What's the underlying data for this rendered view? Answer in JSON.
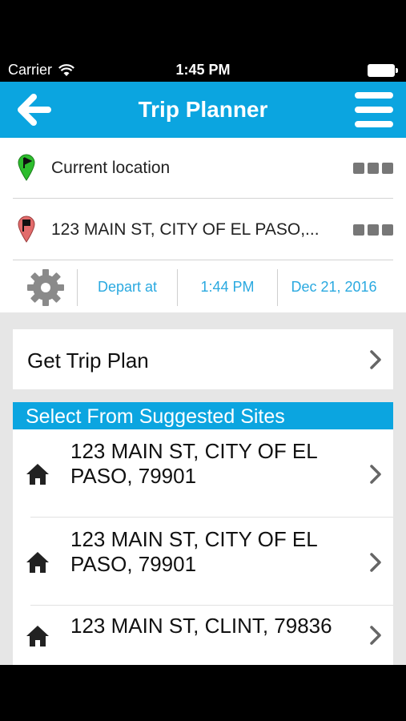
{
  "status_bar": {
    "carrier": "Carrier",
    "time": "1:45 PM"
  },
  "header": {
    "title": "Trip Planner",
    "back_icon": "arrow-left-icon",
    "menu_icon": "hamburger-menu-icon",
    "color": "#0ba5e0"
  },
  "locations": {
    "origin": {
      "label": "Current location",
      "pin_color": "#2dbd2d"
    },
    "destination": {
      "label": "123 MAIN ST, CITY OF EL PASO,...",
      "pin_color": "#e26b6b"
    }
  },
  "options": {
    "depart_mode": "Depart at",
    "time": "1:44 PM",
    "date": "Dec 21, 2016",
    "accent": "#2aa9e0"
  },
  "get_plan": {
    "label": "Get Trip Plan"
  },
  "suggested": {
    "header": "Select From Suggested Sites",
    "items": [
      {
        "line1": "123 MAIN ST, CITY OF EL",
        "line2": "PASO, 79901"
      },
      {
        "line1": "123 MAIN ST, CITY OF EL",
        "line2": "PASO, 79901"
      },
      {
        "line1": "123 MAIN ST, CLINT, 79836",
        "line2": ""
      }
    ]
  }
}
